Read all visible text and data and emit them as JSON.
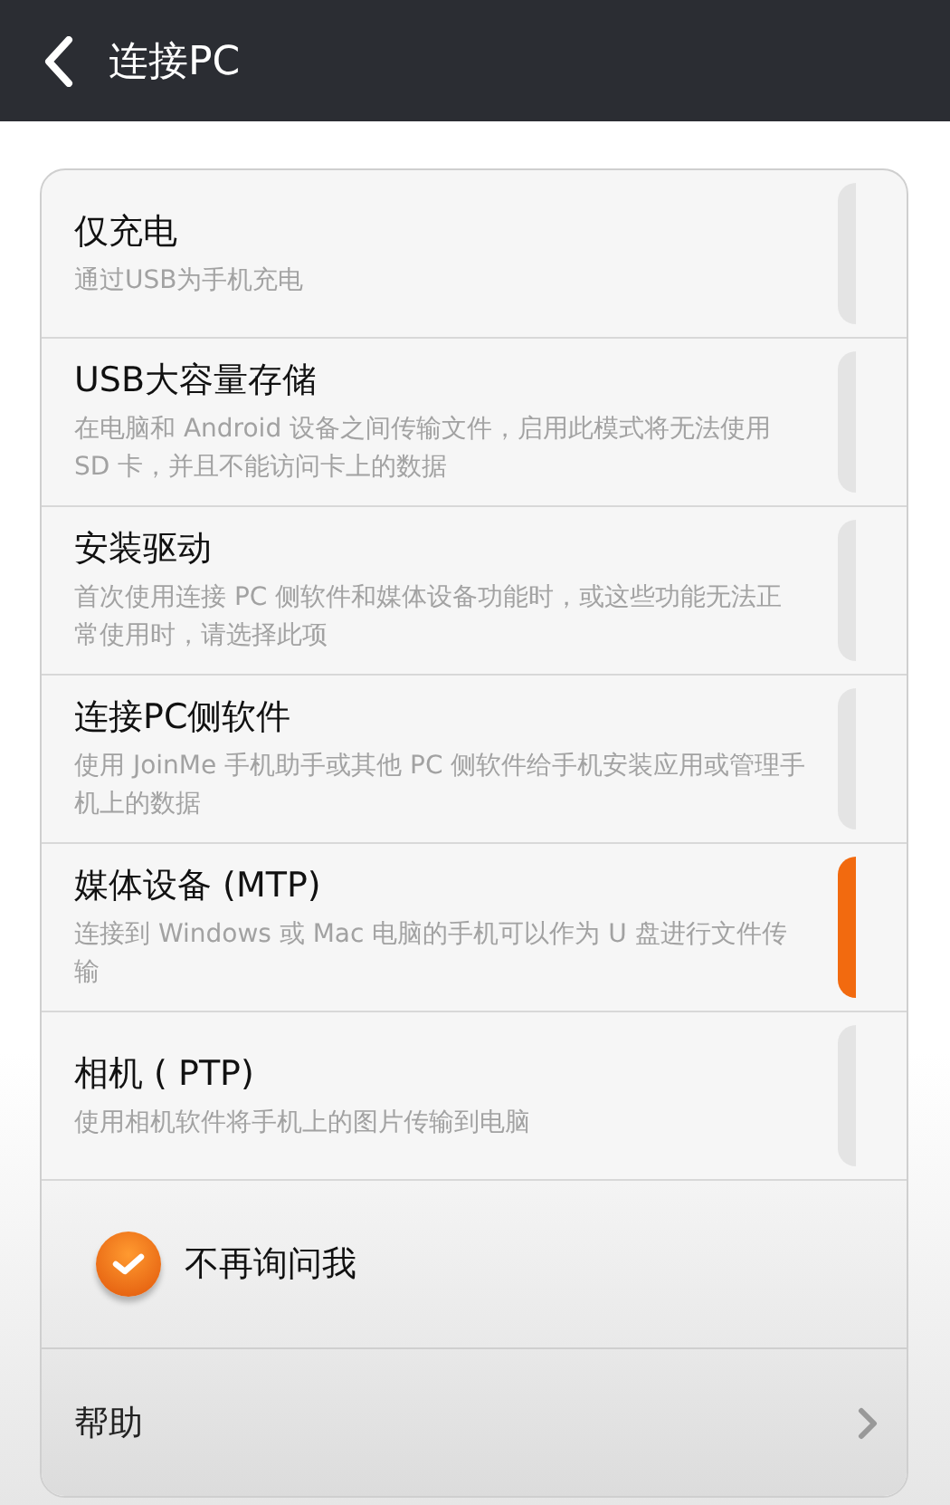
{
  "header": {
    "title": "连接PC"
  },
  "options": [
    {
      "title": "仅充电",
      "description": "通过USB为手机充电",
      "selected": false
    },
    {
      "title": "USB大容量存储",
      "description": "在电脑和 Android 设备之间传输文件，启用此模式将无法使用 SD 卡，并且不能访问卡上的数据",
      "selected": false
    },
    {
      "title": "安装驱动",
      "description": "首次使用连接 PC 侧软件和媒体设备功能时，或这些功能无法正常使用时，请选择此项",
      "selected": false
    },
    {
      "title": "连接PC侧软件",
      "description": "使用 JoinMe 手机助手或其他 PC 侧软件给手机安装应用或管理手机上的数据",
      "selected": false
    },
    {
      "title": "媒体设备 (MTP)",
      "description": "连接到 Windows 或 Mac 电脑的手机可以作为 U 盘进行文件传输",
      "selected": true
    },
    {
      "title": "相机 ( PTP)",
      "description": "使用相机软件将手机上的图片传输到电脑",
      "selected": false
    }
  ],
  "dont_ask": {
    "label": "不再询问我",
    "checked": true
  },
  "help": {
    "label": "帮助"
  }
}
